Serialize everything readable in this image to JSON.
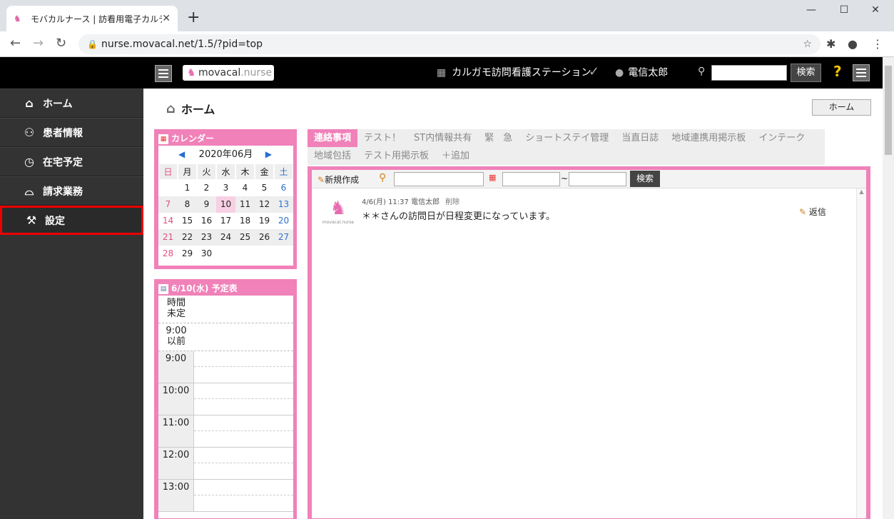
{
  "browser": {
    "tab_title": "モバカルナース | 訪看用電子カルテ",
    "url": "nurse.movacal.net/1.5/?pid=top"
  },
  "header": {
    "logo_main": "movacal",
    "logo_sub": ".nurse",
    "station": "カルガモ訪問看護ステーション",
    "user": "電信太郎",
    "search_button": "検索",
    "help": "?"
  },
  "sidebar": {
    "items": [
      {
        "label": "ホーム",
        "icon": "home-icon"
      },
      {
        "label": "患者情報",
        "icon": "users-icon"
      },
      {
        "label": "在宅予定",
        "icon": "clock-icon"
      },
      {
        "label": "請求業務",
        "icon": "inbox-icon"
      },
      {
        "label": "設定",
        "icon": "tools-icon"
      }
    ]
  },
  "page": {
    "title": "ホーム",
    "home_button": "ホーム"
  },
  "calendar": {
    "title": "カレンダー",
    "month": "2020年06月",
    "weekdays": [
      "日",
      "月",
      "火",
      "水",
      "木",
      "金",
      "土"
    ],
    "weeks": [
      [
        "",
        "1",
        "2",
        "3",
        "4",
        "5",
        "6"
      ],
      [
        "7",
        "8",
        "9",
        "10",
        "11",
        "12",
        "13"
      ],
      [
        "14",
        "15",
        "16",
        "17",
        "18",
        "19",
        "20"
      ],
      [
        "21",
        "22",
        "23",
        "24",
        "25",
        "26",
        "27"
      ],
      [
        "28",
        "29",
        "30",
        "",
        "",
        "",
        ""
      ]
    ],
    "today": "10"
  },
  "schedule": {
    "title": "6/10(水) 予定表",
    "undetermined": "時間\n未定",
    "before": "9:00\n以前",
    "hours": [
      "9:00",
      "10:00",
      "11:00",
      "12:00",
      "13:00"
    ]
  },
  "tabs": {
    "row1": [
      "連絡事項",
      "テスト！",
      "ST内情報共有",
      "緊　急",
      "ショートステイ管理",
      "当直日誌",
      "地域連携用掲示板",
      "インテーク"
    ],
    "row2": [
      "地域包括",
      "テスト用掲示板",
      "＋追加"
    ]
  },
  "board": {
    "new_label": "新規作成",
    "tilde": "~",
    "search_button": "検索"
  },
  "message": {
    "meta": "4/6(月) 11:37 電信太郎",
    "delete": "削除",
    "body": "＊＊さんの訪問日が日程変更になっています。",
    "reply": "返信",
    "avatar_label": "movacal.nurse"
  }
}
